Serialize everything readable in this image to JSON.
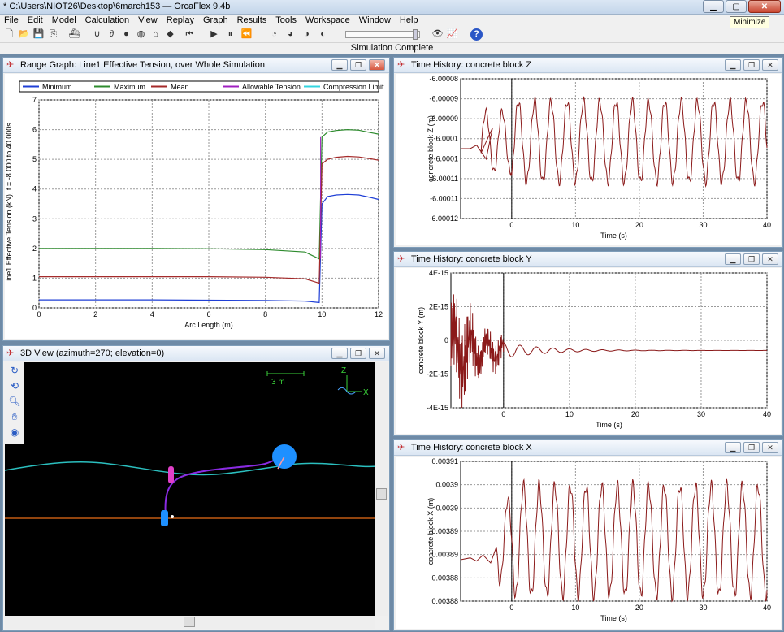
{
  "app": {
    "title": "* C:\\Users\\NIOT26\\Desktop\\6march153 — OrcaFlex 9.4b",
    "tooltip": "Minimize",
    "status": "Simulation Complete"
  },
  "menu": [
    "File",
    "Edit",
    "Model",
    "Calculation",
    "View",
    "Replay",
    "Graph",
    "Results",
    "Tools",
    "Workspace",
    "Window",
    "Help"
  ],
  "toolbar_icons": [
    "new-icon",
    "open-icon",
    "save-icon",
    "copy-icon",
    "ship-icon",
    "magnet-icon",
    "link-icon",
    "buoy-icon",
    "winch-icon",
    "shape-icon",
    "eraser-icon",
    "step-back-icon",
    "play-icon",
    "pause-icon",
    "rewind-icon",
    "calc-static-icon",
    "run-icon",
    "pause-run-icon",
    "reset-icon",
    "eye-icon",
    "graph-icon",
    "help-icon"
  ],
  "windows": {
    "range": {
      "title": "Range Graph: Line1 Effective Tension, over Whole Simulation",
      "legend": [
        "Minimum",
        "Maximum",
        "Mean",
        "Allowable Tension",
        "Compression Limit"
      ],
      "legend_colors": [
        "#1f3fd6",
        "#2e8b2e",
        "#a52a2a",
        "#a020c0",
        "#33d6e0"
      ],
      "xlabel": "Arc Length (m)",
      "ylabel": "Line1 Effective Tension (kN), t = -8.000 to 40.000s"
    },
    "view3d": {
      "title": "3D View (azimuth=270; elevation=0)",
      "scale_label": "3 m",
      "axis_z": "Z",
      "axis_x": "X"
    },
    "z": {
      "title": "Time History: concrete block Z",
      "xlabel": "Time (s)",
      "ylabel": "concrete block Z (m)"
    },
    "y": {
      "title": "Time History: concrete block Y",
      "xlabel": "Time (s)",
      "ylabel": "concrete block Y (m)"
    },
    "x": {
      "title": "Time History: concrete block X",
      "xlabel": "Time (s)",
      "ylabel": "concrete block X (m)"
    }
  },
  "chart_data": [
    {
      "id": "range",
      "type": "line",
      "xlim": [
        0,
        12
      ],
      "ylim": [
        0,
        7
      ],
      "xticks": [
        "0",
        "2",
        "4",
        "6",
        "8",
        "10",
        "12"
      ],
      "yticks": [
        "0",
        "1",
        "2",
        "3",
        "4",
        "5",
        "6",
        "7"
      ],
      "grid": true,
      "legend_position": "top",
      "series": [
        {
          "name": "Minimum",
          "color": "#1f3fd6",
          "x": [
            0,
            2,
            4,
            6,
            8,
            9.4,
            9.9,
            10.0,
            10.2,
            10.5,
            10.9,
            11.3,
            11.7,
            12
          ],
          "y": [
            0.27,
            0.27,
            0.27,
            0.26,
            0.25,
            0.23,
            0.18,
            3.5,
            3.75,
            3.8,
            3.82,
            3.8,
            3.72,
            3.65
          ]
        },
        {
          "name": "Maximum",
          "color": "#2e8b2e",
          "x": [
            0,
            2,
            4,
            6,
            8,
            9.4,
            9.9,
            10.0,
            10.2,
            10.5,
            10.9,
            11.3,
            11.7,
            12
          ],
          "y": [
            2.0,
            2.0,
            2.0,
            1.99,
            1.96,
            1.88,
            1.65,
            5.75,
            5.92,
            5.97,
            6.0,
            5.98,
            5.9,
            5.85
          ]
        },
        {
          "name": "Mean",
          "color": "#a52a2a",
          "x": [
            0,
            2,
            4,
            6,
            8,
            9.4,
            9.9,
            10.0,
            10.2,
            10.5,
            10.9,
            11.3,
            11.7,
            12
          ],
          "y": [
            1.05,
            1.05,
            1.05,
            1.05,
            1.03,
            0.98,
            0.83,
            4.85,
            5.0,
            5.07,
            5.1,
            5.08,
            5.02,
            4.97
          ]
        }
      ]
    },
    {
      "id": "z",
      "type": "line",
      "xlim": [
        -8,
        40
      ],
      "ylim": [
        -6.00012,
        -6.00008
      ],
      "xticks": [
        "0",
        "10",
        "20",
        "30",
        "40"
      ],
      "yticks": [
        "-6.00008",
        "-6.00009",
        "-6.00009",
        "-6.0001",
        "-6.0001",
        "-6.00011",
        "-6.00011",
        "-6.00012"
      ],
      "grid": true,
      "series": [
        {
          "name": "",
          "color": "#8b1a1a",
          "osc": {
            "mean": -6.000098,
            "amp": 1.15e-05,
            "period": 2.55,
            "start": -6.6,
            "t0": -4.8,
            "pre": [
              [
                -8,
                -6.0001
              ],
              [
                -6.5,
                -6.0001
              ],
              [
                -5.5,
                -6.000099
              ],
              [
                -4,
                -6.000103
              ],
              [
                -3,
                -6.000094
              ]
            ]
          }
        }
      ]
    },
    {
      "id": "y",
      "type": "line",
      "xlim": [
        -8,
        40
      ],
      "ylim": [
        -4e-15,
        4e-15
      ],
      "xticks": [
        "0",
        "10",
        "20",
        "30",
        "40"
      ],
      "yticks": [
        "4E-15",
        "2E-15",
        "0",
        "-2E-15",
        "-4E-15"
      ],
      "grid": true,
      "series": [
        {
          "name": "",
          "color": "#8b1a1a",
          "decay": {
            "offset": -6e-16,
            "amp0": 3.5e-15,
            "period": 2.5,
            "tau": 6.5
          }
        }
      ]
    },
    {
      "id": "x",
      "type": "line",
      "xlim": [
        -8,
        40
      ],
      "ylim": [
        0.00388,
        0.00391
      ],
      "xticks": [
        "0",
        "10",
        "20",
        "30",
        "40"
      ],
      "yticks": [
        "0.00391",
        "0.0039",
        "0.0039",
        "0.00389",
        "0.00389",
        "0.00388",
        "0.00388"
      ],
      "grid": true,
      "series": [
        {
          "name": "",
          "color": "#8b1a1a",
          "osc": {
            "mean": 0.003893,
            "amp": 1.18e-05,
            "period": 2.45,
            "start": -5.5,
            "t0": -2.4,
            "pre": [
              [
                -8,
                0.0038889
              ],
              [
                -6.5,
                0.0038893
              ],
              [
                -5.5,
                0.0038886
              ],
              [
                -4.5,
                0.0038899
              ],
              [
                -3.3,
                0.0038882
              ]
            ]
          }
        }
      ]
    }
  ]
}
